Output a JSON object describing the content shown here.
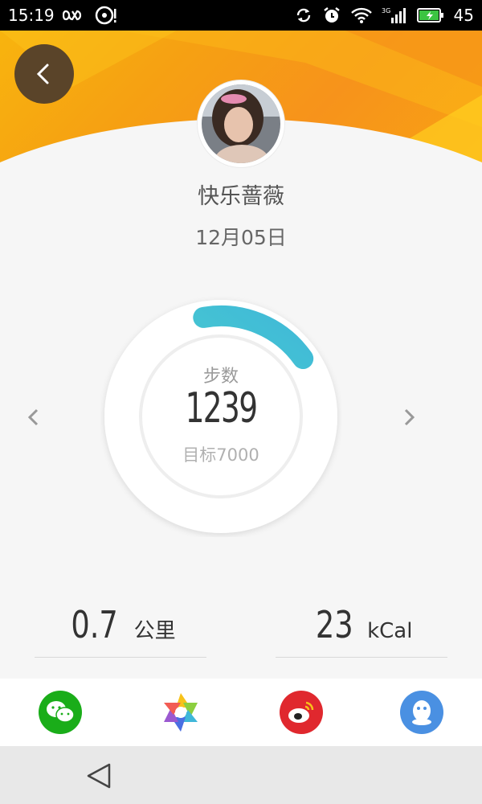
{
  "status_bar": {
    "time": "15:19",
    "battery_level": "45",
    "network": "3G",
    "icons": [
      "infinity-icon",
      "music-disc-icon",
      "sync-icon",
      "alarm-icon",
      "wifi-icon",
      "signal-icon",
      "battery-icon"
    ]
  },
  "profile": {
    "name": "快乐蔷薇",
    "date": "12月05日"
  },
  "steps": {
    "label": "步数",
    "value": "1239",
    "goal_text": "目标7000",
    "progress": 0.18
  },
  "metrics": {
    "distance_value": "0.7",
    "distance_unit": "公里",
    "calories_value": "23",
    "calories_unit": "kCal"
  },
  "share": {
    "items": [
      "wechat-icon",
      "moments-icon",
      "weibo-icon",
      "qq-icon"
    ]
  },
  "colors": {
    "header_orange": "#f7a012",
    "ring_start": "#52e0c4",
    "ring_end": "#3fb7d9",
    "wechat": "#1aad19",
    "weibo": "#e0282e",
    "qq": "#4a90e2"
  }
}
